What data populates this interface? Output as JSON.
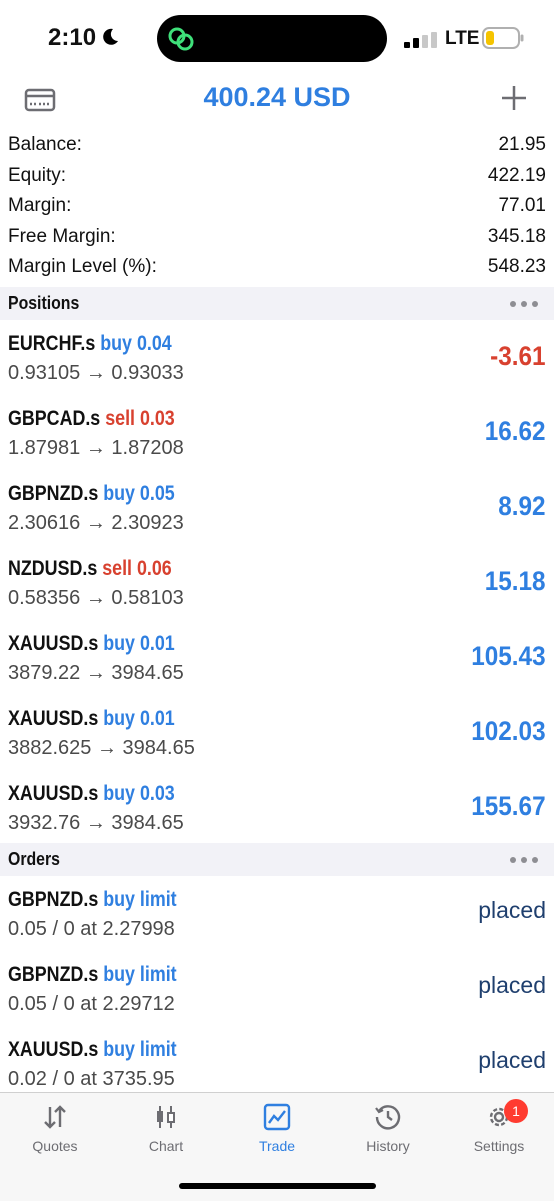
{
  "status_bar": {
    "time": "2:10",
    "carrier": "LTE"
  },
  "header": {
    "title": "400.24 USD"
  },
  "summary": [
    {
      "label": "Balance:",
      "value": "21.95"
    },
    {
      "label": "Equity:",
      "value": "422.19"
    },
    {
      "label": "Margin:",
      "value": "77.01"
    },
    {
      "label": "Free Margin:",
      "value": "345.18"
    },
    {
      "label": "Margin Level (%):",
      "value": "548.23"
    }
  ],
  "positions_section": {
    "title": "Positions"
  },
  "positions": [
    {
      "symbol": "EURCHF.s",
      "side": "buy",
      "volume": "0.04",
      "prices": "0.93105 → 0.93033",
      "profit": "-3.61"
    },
    {
      "symbol": "GBPCAD.s",
      "side": "sell",
      "volume": "0.03",
      "prices": "1.87981 → 1.87208",
      "profit": "16.62"
    },
    {
      "symbol": "GBPNZD.s",
      "side": "buy",
      "volume": "0.05",
      "prices": "2.30616 → 2.30923",
      "profit": "8.92"
    },
    {
      "symbol": "NZDUSD.s",
      "side": "sell",
      "volume": "0.06",
      "prices": "0.58356 → 0.58103",
      "profit": "15.18"
    },
    {
      "symbol": "XAUUSD.s",
      "side": "buy",
      "volume": "0.01",
      "prices": "3879.22 → 3984.65",
      "profit": "105.43"
    },
    {
      "symbol": "XAUUSD.s",
      "side": "buy",
      "volume": "0.01",
      "prices": "3882.625 → 3984.65",
      "profit": "102.03"
    },
    {
      "symbol": "XAUUSD.s",
      "side": "buy",
      "volume": "0.03",
      "prices": "3932.76 → 3984.65",
      "profit": "155.67"
    }
  ],
  "orders_section": {
    "title": "Orders"
  },
  "orders": [
    {
      "symbol": "GBPNZD.s",
      "type": "buy limit",
      "details": "0.05 / 0 at 2.27998",
      "state": "placed"
    },
    {
      "symbol": "GBPNZD.s",
      "type": "buy limit",
      "details": "0.05 / 0 at 2.29712",
      "state": "placed"
    },
    {
      "symbol": "XAUUSD.s",
      "type": "buy limit",
      "details": "0.02 / 0 at 3735.95",
      "state": "placed"
    }
  ],
  "tabs": [
    {
      "label": "Quotes",
      "icon": "quotes-arrows-icon"
    },
    {
      "label": "Chart",
      "icon": "candlestick-icon"
    },
    {
      "label": "Trade",
      "icon": "trade-chart-icon",
      "active": true
    },
    {
      "label": "History",
      "icon": "history-clock-icon"
    },
    {
      "label": "Settings",
      "icon": "gear-icon",
      "badge": "1"
    }
  ],
  "colors": {
    "accent": "#2f7fe0",
    "loss": "#d8412f",
    "placed": "#1f3f6e"
  }
}
